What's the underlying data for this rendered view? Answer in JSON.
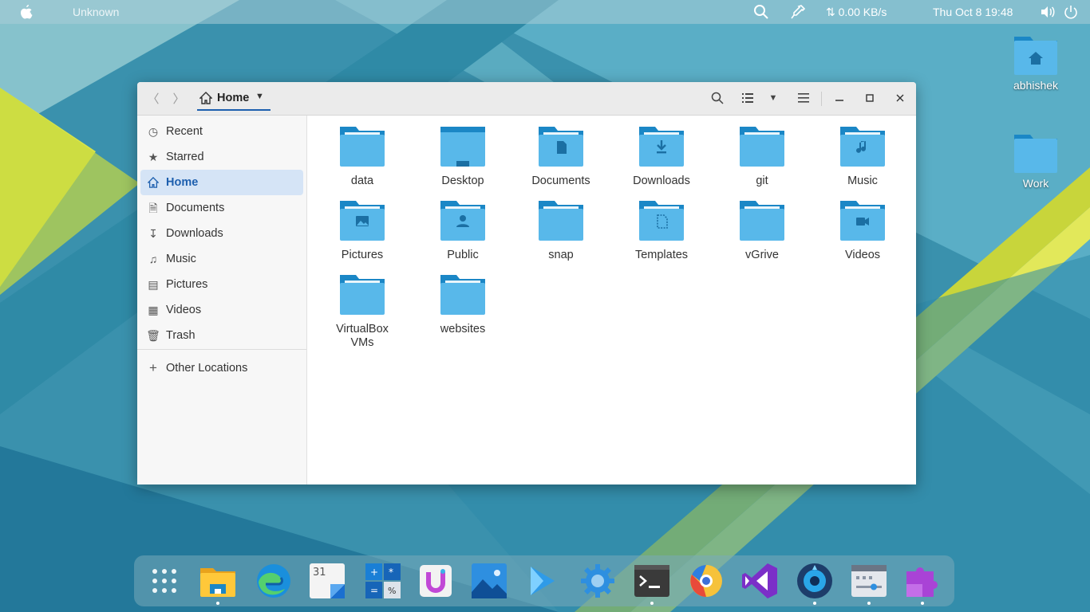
{
  "topbar": {
    "app_name": "Unknown",
    "network_speed": "⇅ 0.00 KB/s",
    "datetime": "Thu Oct 8  19:48"
  },
  "desktop_icons": [
    {
      "label": "abhishek",
      "icon": "home-folder-icon"
    },
    {
      "label": "Work",
      "icon": "folder-icon"
    }
  ],
  "window": {
    "path_label": "Home",
    "sidebar": {
      "items": [
        {
          "label": "Recent",
          "icon": "clock-icon"
        },
        {
          "label": "Starred",
          "icon": "star-icon"
        },
        {
          "label": "Home",
          "icon": "home-icon",
          "active": true
        },
        {
          "label": "Documents",
          "icon": "document-icon"
        },
        {
          "label": "Downloads",
          "icon": "download-icon"
        },
        {
          "label": "Music",
          "icon": "music-icon"
        },
        {
          "label": "Pictures",
          "icon": "picture-icon"
        },
        {
          "label": "Videos",
          "icon": "film-icon"
        },
        {
          "label": "Trash",
          "icon": "trash-icon"
        }
      ],
      "other_locations": "Other Locations"
    },
    "files": [
      {
        "label": "data",
        "emblem": "none"
      },
      {
        "label": "Desktop",
        "emblem": "desktop"
      },
      {
        "label": "Documents",
        "emblem": "document"
      },
      {
        "label": "Downloads",
        "emblem": "download"
      },
      {
        "label": "git",
        "emblem": "none"
      },
      {
        "label": "Music",
        "emblem": "music"
      },
      {
        "label": "Pictures",
        "emblem": "picture"
      },
      {
        "label": "Public",
        "emblem": "user"
      },
      {
        "label": "snap",
        "emblem": "none"
      },
      {
        "label": "Templates",
        "emblem": "template"
      },
      {
        "label": "vGrive",
        "emblem": "none"
      },
      {
        "label": "Videos",
        "emblem": "video"
      },
      {
        "label": "VirtualBox VMs",
        "emblem": "none"
      },
      {
        "label": "websites",
        "emblem": "none"
      }
    ]
  },
  "dock": {
    "apps": [
      {
        "name": "app-grid-icon"
      },
      {
        "name": "files-icon",
        "running": true
      },
      {
        "name": "edge-browser-icon"
      },
      {
        "name": "calendar-icon"
      },
      {
        "name": "calculator-icon"
      },
      {
        "name": "ulauncher-icon"
      },
      {
        "name": "image-viewer-icon"
      },
      {
        "name": "media-player-icon"
      },
      {
        "name": "settings-icon"
      },
      {
        "name": "terminal-icon",
        "running": true
      },
      {
        "name": "web-browser-icon"
      },
      {
        "name": "visual-studio-icon"
      },
      {
        "name": "disk-utility-icon",
        "running": true
      },
      {
        "name": "system-monitor-icon",
        "running": true
      },
      {
        "name": "extensions-icon",
        "running": true
      }
    ]
  },
  "colors": {
    "folder_light": "#58b8ea",
    "folder_dark": "#1b87c6",
    "accent": "#1d5fae"
  }
}
